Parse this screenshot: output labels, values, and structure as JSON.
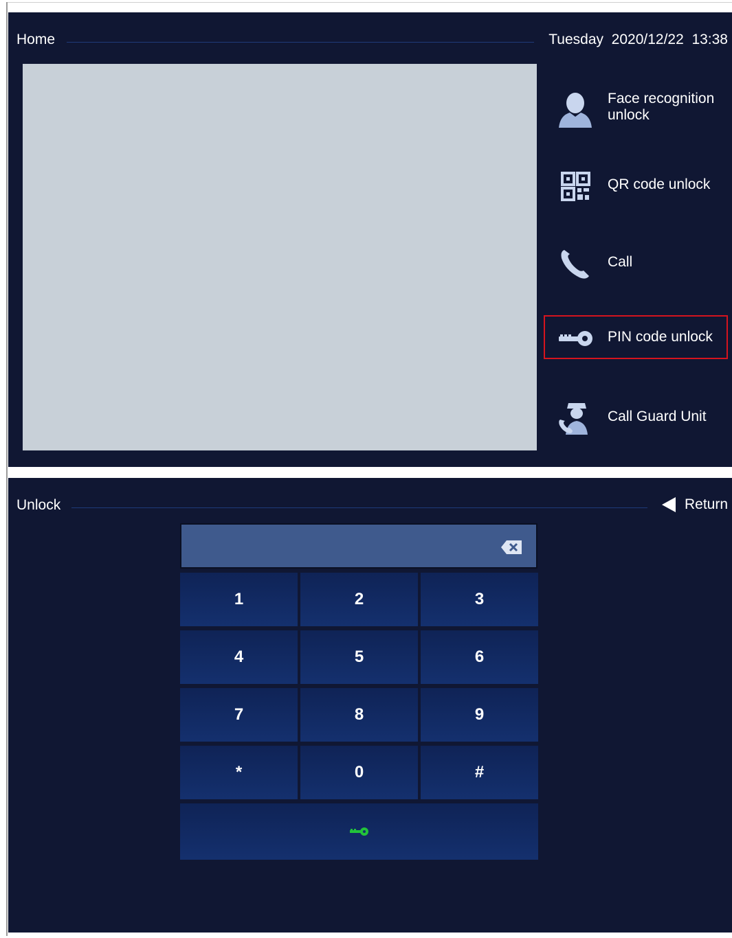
{
  "home": {
    "title": "Home",
    "datetime": "Tuesday  2020/12/22  13:38",
    "menu": [
      {
        "label": "Face recognition unlock",
        "icon": "person-icon"
      },
      {
        "label": "QR code unlock",
        "icon": "qr-code-icon"
      },
      {
        "label": "Call",
        "icon": "phone-icon"
      },
      {
        "label": "PIN code unlock",
        "icon": "key-icon",
        "selected": true
      },
      {
        "label": "Call Guard Unit",
        "icon": "guard-icon"
      }
    ]
  },
  "unlock": {
    "title": "Unlock",
    "return_label": "Return",
    "pin_value": "",
    "keys": [
      "1",
      "2",
      "3",
      "4",
      "5",
      "6",
      "7",
      "8",
      "9",
      "*",
      "0",
      "#"
    ],
    "unlock_icon": "key-icon"
  },
  "colors": {
    "background": "#101733",
    "video_placeholder": "#c8d0d8",
    "selection_border": "#d6141e",
    "input_bar": "#3f5a8d",
    "key_fill": "#14306e",
    "unlock_key": "#22c33a"
  }
}
